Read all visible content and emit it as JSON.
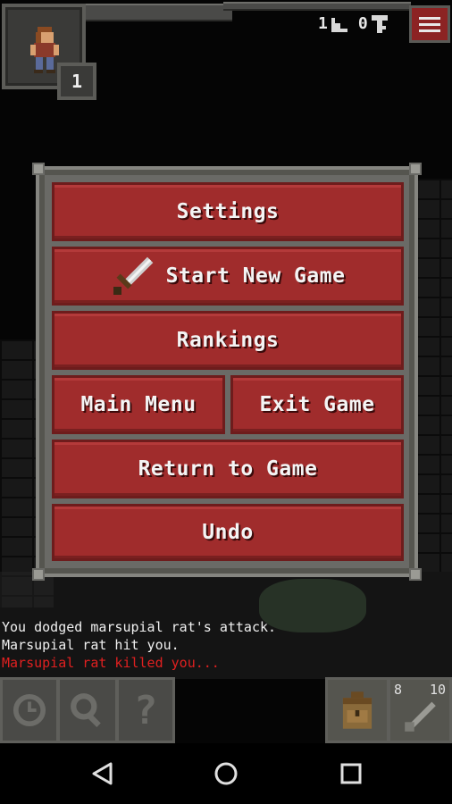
{
  "status": {
    "hero_level": "1",
    "depth": "1",
    "keys": "0"
  },
  "menu": {
    "settings": "Settings",
    "start_new_game": "Start New Game",
    "rankings": "Rankings",
    "main_menu": "Main Menu",
    "exit_game": "Exit Game",
    "return_to_game": "Return to Game",
    "undo": "Undo"
  },
  "log": [
    "You dodged marsupial rat's attack.",
    "Marsupial rat hit you.",
    "Marsupial rat killed you..."
  ],
  "toolbar": {
    "quickslot_count_left": "8",
    "quickslot_count_right": "10",
    "help_glyph": "?"
  },
  "icons": {
    "menu": "hamburger-icon",
    "depth": "stairs-icon",
    "keys": "key-icon",
    "wait": "clock-icon",
    "search": "magnifier-icon",
    "info": "question-icon",
    "inventory": "backpack-icon",
    "quickslot": "dart-icon",
    "sword": "sword-icon"
  },
  "colors": {
    "button_red": "#a02c2c",
    "frame_gray": "#6a6a66",
    "death_text": "#e02020"
  }
}
